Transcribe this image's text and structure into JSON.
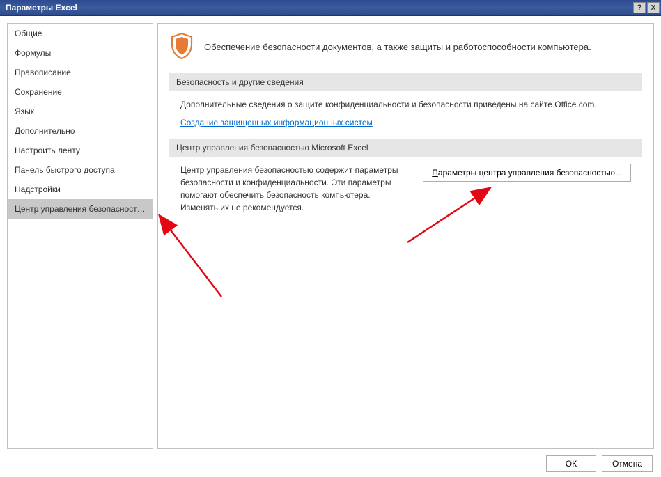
{
  "titlebar": {
    "title": "Параметры Excel",
    "help_label": "?",
    "close_label": "X"
  },
  "sidebar": {
    "items": [
      {
        "label": "Общие"
      },
      {
        "label": "Формулы"
      },
      {
        "label": "Правописание"
      },
      {
        "label": "Сохранение"
      },
      {
        "label": "Язык"
      },
      {
        "label": "Дополнительно"
      },
      {
        "label": "Настроить ленту"
      },
      {
        "label": "Панель быстрого доступа"
      },
      {
        "label": "Надстройки"
      },
      {
        "label": "Центр управления безопасностью"
      }
    ],
    "selected_index": 9
  },
  "content": {
    "intro": "Обеспечение безопасности документов, а также защиты и работоспособности компьютера.",
    "section1": {
      "header": "Безопасность и другие сведения",
      "text": "Дополнительные сведения о защите конфиденциальности и безопасности приведены на сайте Office.com.",
      "link": "Создание защищенных информационных систем"
    },
    "section2": {
      "header": "Центр управления безопасностью Microsoft Excel",
      "text": "Центр управления безопасностью содержит параметры безопасности и конфиденциальности. Эти параметры помогают обеспечить безопасность компьютера. Изменять их не рекомендуется.",
      "button": "Параметры центра управления безопасностью..."
    }
  },
  "footer": {
    "ok": "ОК",
    "cancel": "Отмена"
  }
}
